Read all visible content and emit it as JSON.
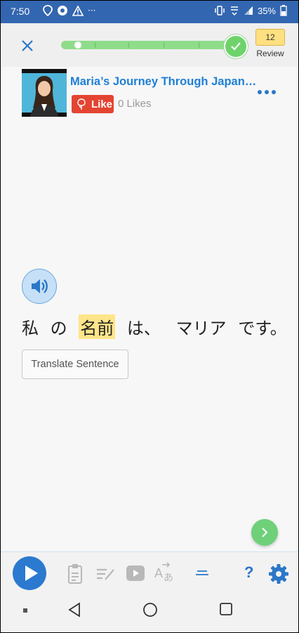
{
  "status_bar": {
    "time": "7:50",
    "battery": "35%",
    "dots": "···"
  },
  "header": {
    "review_count": "12",
    "review_label": "Review",
    "progress": 1.0
  },
  "lesson": {
    "title": "Maria’s Journey Through Japan-…",
    "like_label": "Like",
    "likes_text": "0 Likes"
  },
  "sentence": {
    "words": [
      "私",
      "の",
      "名前",
      "は、",
      "マリア",
      "です。"
    ],
    "highlighted_index": 2,
    "translate_label": "Translate Sentence"
  },
  "toolbar": {
    "help_label": "?"
  },
  "colors": {
    "status_bar": "#3366b0",
    "accent_blue": "#2b77c9",
    "progress_green": "#8fdc8a",
    "highlight": "#ffe58a",
    "like_red": "#e44432"
  }
}
